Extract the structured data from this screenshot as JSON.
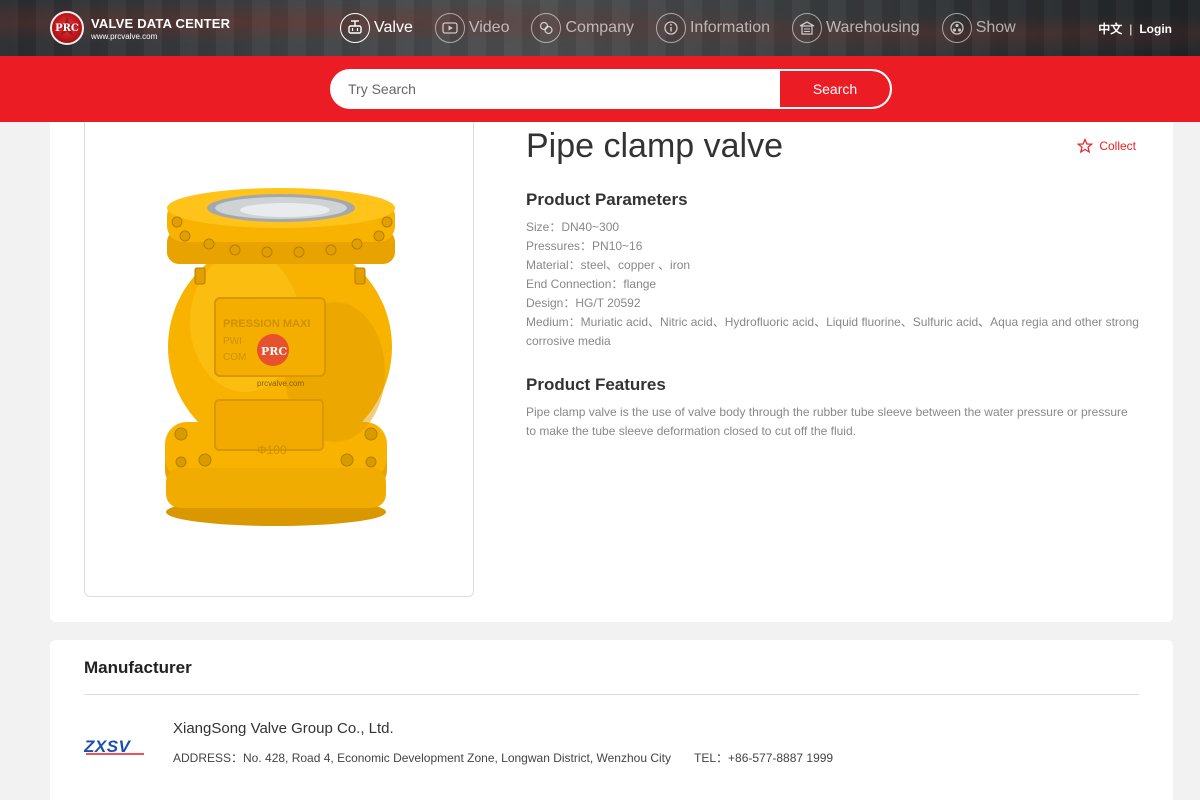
{
  "brand": {
    "mark_text": "PRC",
    "title": "VALVE DATA CENTER",
    "url": "www.prcvalve.com"
  },
  "nav": {
    "items": [
      {
        "label": "Valve",
        "icon": "valve-icon",
        "active": true
      },
      {
        "label": "Video",
        "icon": "video-icon",
        "active": false
      },
      {
        "label": "Company",
        "icon": "company-icon",
        "active": false
      },
      {
        "label": "Information",
        "icon": "information-icon",
        "active": false
      },
      {
        "label": "Warehousing",
        "icon": "warehouse-icon",
        "active": false
      },
      {
        "label": "Show",
        "icon": "show-icon",
        "active": false
      }
    ],
    "language": "中文",
    "separator": "|",
    "login": "Login"
  },
  "search": {
    "placeholder": "Try Search",
    "value": "",
    "button": "Search"
  },
  "product": {
    "title": "Pipe clamp valve",
    "collect": "Collect",
    "params_title": "Product Parameters",
    "params": [
      "Size：DN40~300",
      "Pressures：PN10~16",
      "Material：steel、copper 、iron",
      "End Connection：flange",
      "Design：HG/T 20592",
      "Medium：Muriatic acid、Nitric acid、Hydrofluoric acid、Liquid fluorine、Sulfuric acid、Aqua regia and other strong corrosive media"
    ],
    "features_title": "Product Features",
    "features": "Pipe clamp valve is the use of valve body through the rubber tube sleeve between the water pressure or pressure to make the tube sleeve deformation closed to cut off the fluid.",
    "image": {
      "plate_text": "PRESSION MAXI",
      "plate_text2": "PWI",
      "plate_text3": "COM",
      "size_text": "Φ100",
      "watermark_mark": "PRC",
      "watermark_url": "prcvalve.com"
    }
  },
  "manufacturer": {
    "heading": "Manufacturer",
    "logo_text": "ZXSV",
    "name": "XiangSong Valve Group Co., Ltd.",
    "address": "ADDRESS：No. 428, Road 4, Economic Development Zone, Longwan District, Wenzhou City",
    "tel": "TEL：+86-577-8887 1999"
  },
  "colors": {
    "accent": "#ec1c24",
    "valve_yellow": "#f7b300",
    "text_muted": "#888888"
  }
}
